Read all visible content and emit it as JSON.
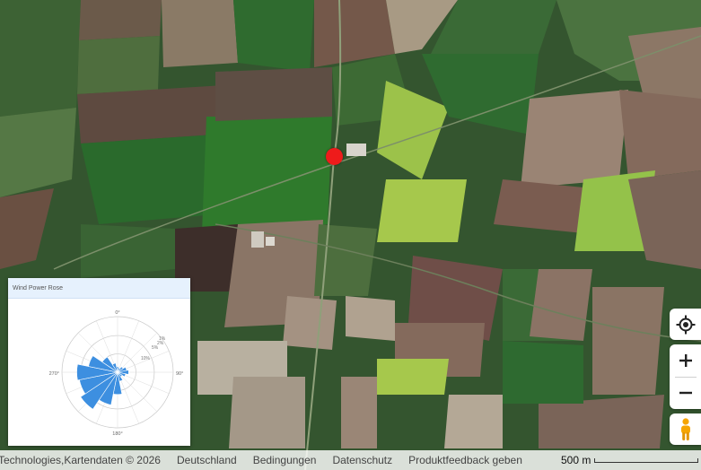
{
  "map": {
    "type": "satellite",
    "marker_color": "#ee1b1b"
  },
  "controls": {
    "locate_icon": "locate-icon",
    "zoom_in_label": "+",
    "zoom_out_label": "−",
    "pegman_icon": "pegman-icon"
  },
  "wind_rose": {
    "title": "Wind Power Rose",
    "direction_labels": [
      "0°",
      "90°",
      "180°",
      "270°"
    ],
    "radial_labels": [
      "10%",
      "1%",
      "5%",
      "2%"
    ],
    "bar_color": "#3d8fe0",
    "directions_deg": [
      0,
      22.5,
      45,
      67.5,
      90,
      112.5,
      135,
      157.5,
      180,
      202.5,
      225,
      247.5,
      270,
      292.5,
      315,
      337.5
    ],
    "values_pct": [
      1.5,
      1.2,
      1.8,
      2.5,
      3.0,
      2.2,
      1.5,
      2.5,
      6.0,
      9.0,
      12.0,
      10.5,
      11.0,
      8.0,
      5.0,
      2.5
    ],
    "max_pct": 15
  },
  "footer": {
    "copyright": "Technologies,Kartendaten © 2026",
    "links": [
      "Deutschland",
      "Bedingungen",
      "Datenschutz",
      "Produktfeedback geben"
    ],
    "scale_label": "500 m"
  }
}
